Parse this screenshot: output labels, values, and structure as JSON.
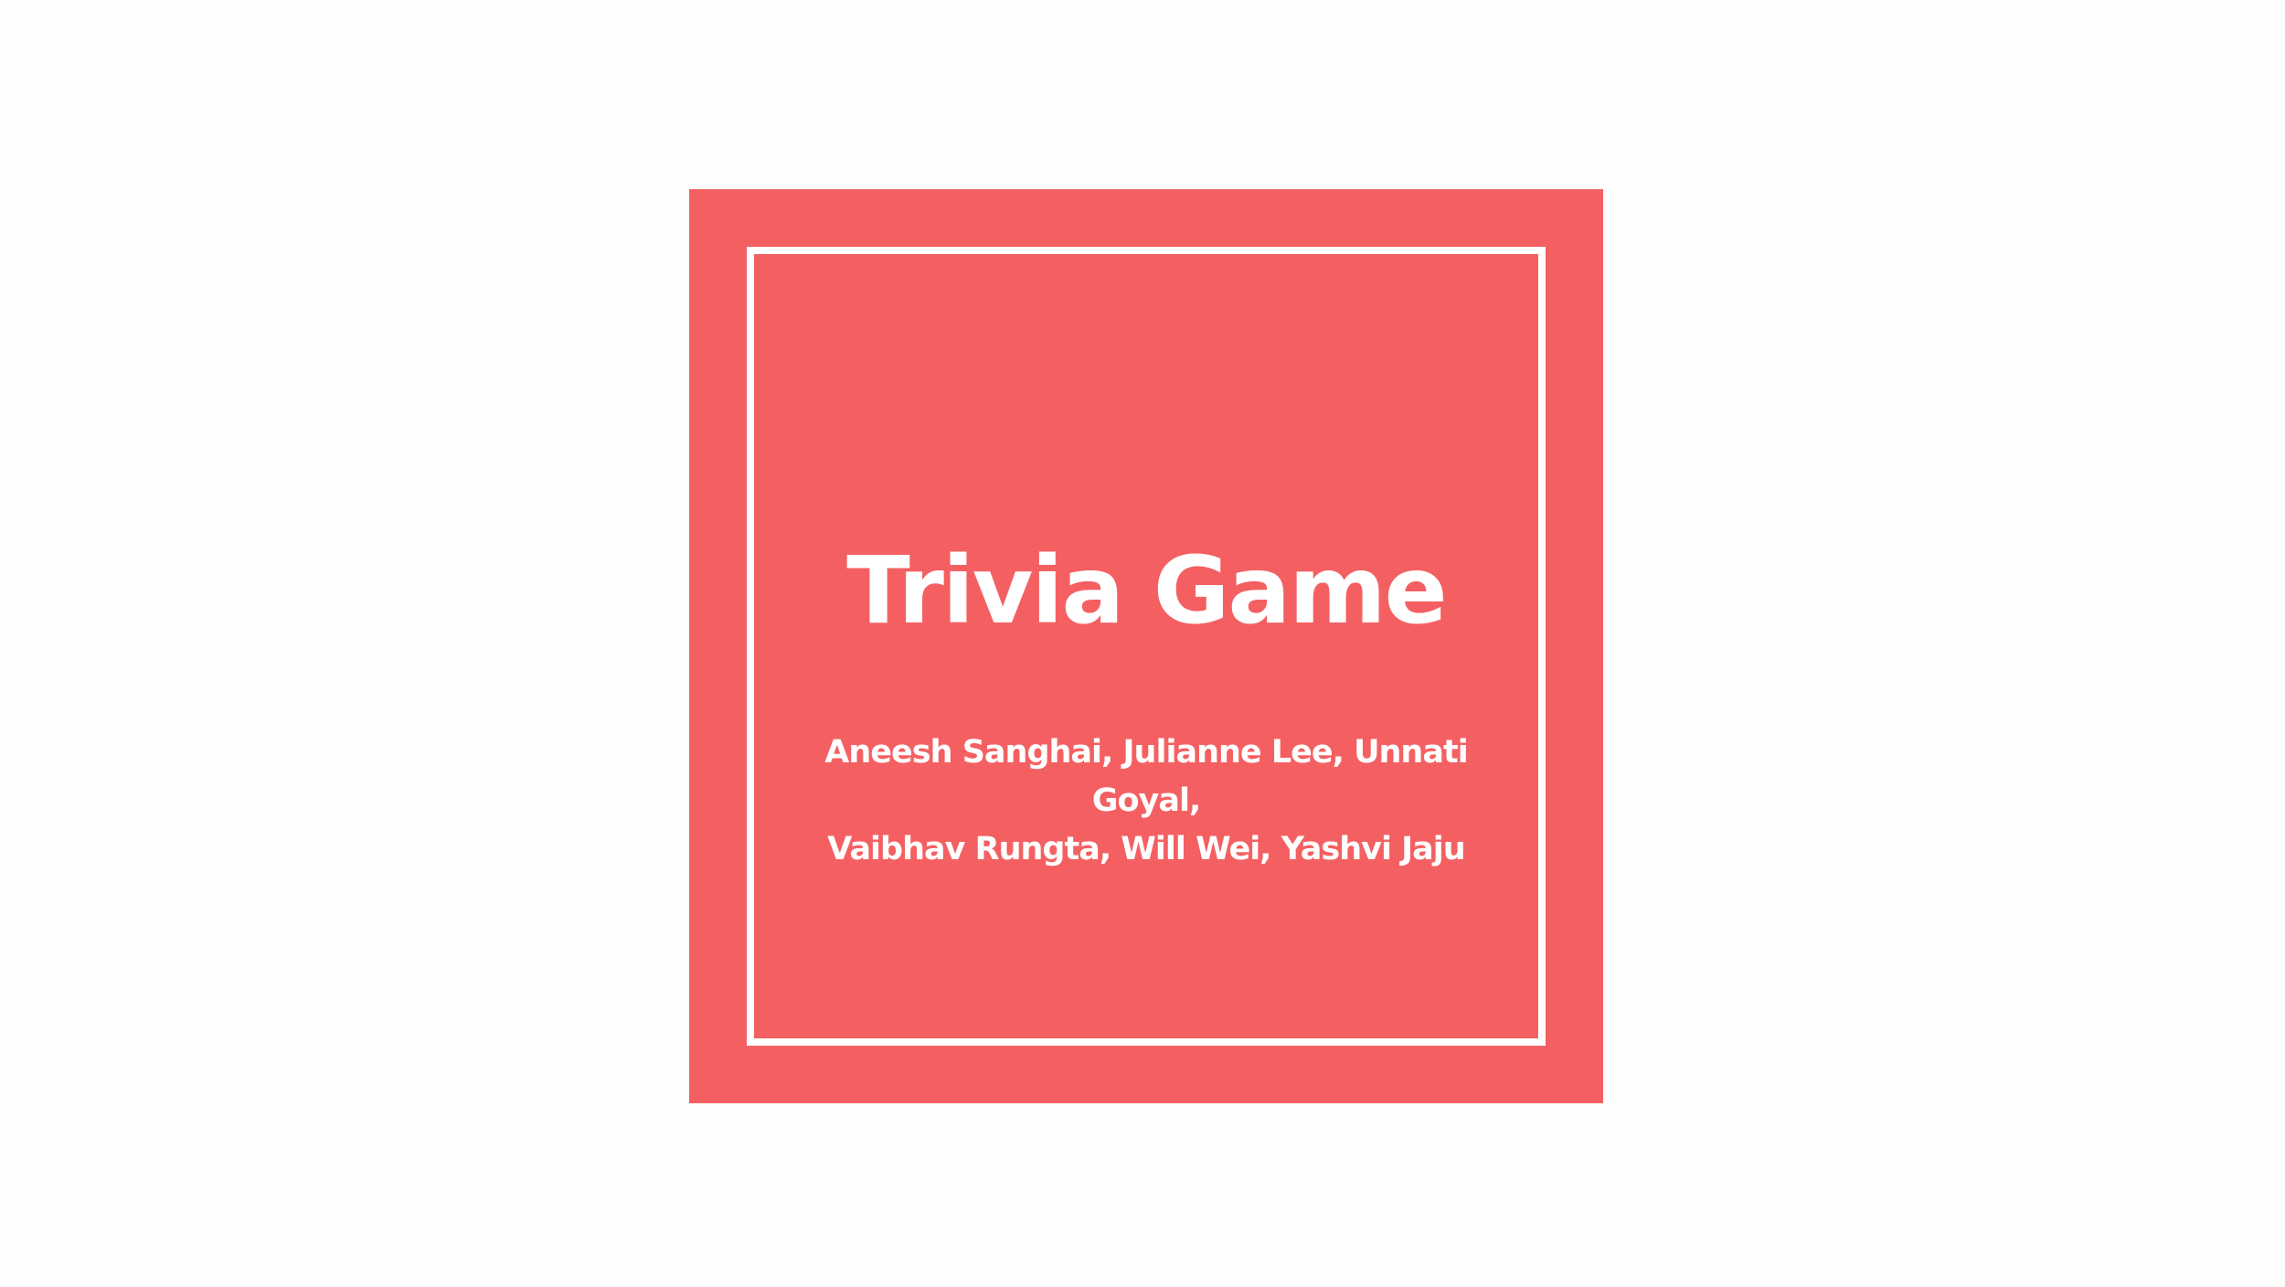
{
  "slide": {
    "title": "Trivia Game",
    "authors_line1": "Aneesh Sanghai, Julianne Lee, Unnati Goyal,",
    "authors_line2": "Vaibhav Rungta, Will Wei, Yashvi Jaju"
  },
  "colors": {
    "background": "#fdfdfd",
    "card": "#f46062",
    "frame": "#ffffff",
    "text": "#ffffff"
  }
}
